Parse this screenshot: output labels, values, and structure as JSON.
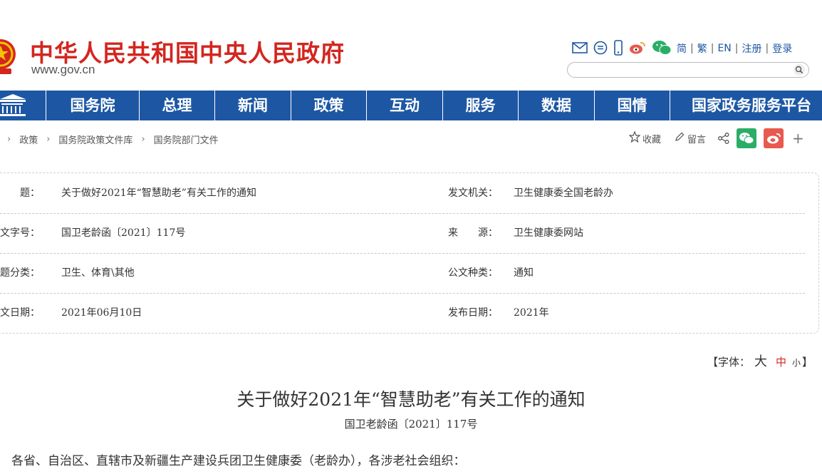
{
  "header": {
    "site_title": "中华人民共和国中央人民政府",
    "site_url": "www.gov.cn",
    "lang_links": [
      "简",
      "繁",
      "EN",
      "注册",
      "登录"
    ],
    "search_placeholder": ""
  },
  "nav": {
    "items": [
      "国务院",
      "总理",
      "新闻",
      "政策",
      "互动",
      "服务",
      "数据",
      "国情",
      "国家政务服务平台"
    ]
  },
  "breadcrumb": {
    "items": [
      "政策",
      "国务院政策文件库",
      "国务院部门文件"
    ]
  },
  "tools": {
    "favorite": "收藏",
    "comment": "留言"
  },
  "info": {
    "rows": [
      {
        "label1": "标　　题：",
        "value1": "关于做好2021年“智慧助老”有关工作的通知",
        "label2": "发文机关：",
        "value2": "卫生健康委全国老龄办"
      },
      {
        "label1": "发文字号：",
        "value1": "国卫老龄函〔2021〕117号",
        "label2": "来　　源：",
        "value2": "卫生健康委网站"
      },
      {
        "label1": "主题分类：",
        "value1": "卫生、体育\\其他",
        "label2": "公文种类：",
        "value2": "通知"
      },
      {
        "label1": "成文日期：",
        "value1": "2021年06月10日",
        "label2": "发布日期：",
        "value2": "2021年"
      }
    ]
  },
  "fontsize": {
    "open": "【字体：",
    "big": "大",
    "mid": "中",
    "small": "小",
    "close": "】"
  },
  "article": {
    "title": "关于做好2021年“智慧助老”有关工作的通知",
    "doc_no": "国卫老龄函〔2021〕117号",
    "first_paragraph": "各省、自治区、直辖市及新疆生产建设兵团卫生健康委（老龄办），各涉老社会组织："
  },
  "colors": {
    "brand_red": "#d3261f",
    "nav_blue": "#1d57a4",
    "wechat_green": "#2aae67",
    "weibo_red": "#e8594e"
  }
}
